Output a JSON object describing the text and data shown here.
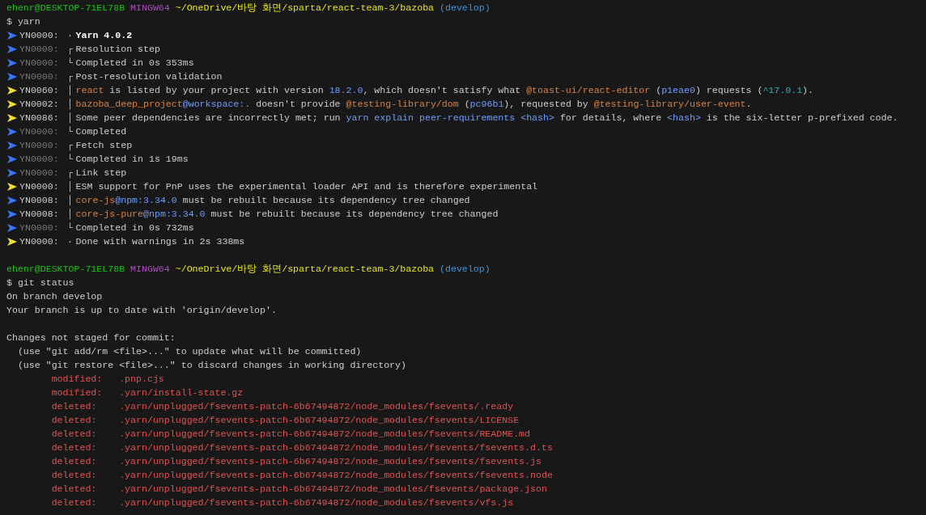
{
  "lines": [
    {
      "kind": "prompt",
      "segments": [
        {
          "kind": "user",
          "text": "ehenr@DESKTOP-71EL78B"
        },
        {
          "kind": "system",
          "text": "MINGW64"
        },
        {
          "kind": "path",
          "text": "~/OneDrive/바탕 화면/sparta/react-team-3/bazoba"
        },
        {
          "kind": "branch",
          "text": "(develop)"
        }
      ]
    },
    {
      "kind": "command",
      "text": "$ yarn"
    },
    {
      "kind": "yarn",
      "warning": false,
      "muted": false,
      "code": "YN0000:",
      "tree": "·",
      "segments": [
        {
          "kind": "bold",
          "text": "Yarn 4.0.2"
        }
      ]
    },
    {
      "kind": "yarn",
      "warning": false,
      "muted": true,
      "code": "YN0000:",
      "tree": "┌",
      "segments": [
        {
          "kind": "plain",
          "text": "Resolution step"
        }
      ]
    },
    {
      "kind": "yarn",
      "warning": false,
      "muted": true,
      "code": "YN0000:",
      "tree": "└",
      "segments": [
        {
          "kind": "plain",
          "text": "Completed in 0s 353ms"
        }
      ]
    },
    {
      "kind": "yarn",
      "warning": false,
      "muted": true,
      "code": "YN0000:",
      "tree": "┌",
      "segments": [
        {
          "kind": "plain",
          "text": "Post-resolution validation"
        }
      ]
    },
    {
      "kind": "yarn",
      "warning": true,
      "muted": false,
      "code": "YN0060:",
      "tree": "│",
      "segments": [
        {
          "kind": "package",
          "text": "react"
        },
        {
          "kind": "plain",
          "text": " is listed by your project with version "
        },
        {
          "kind": "reference",
          "text": "18.2.0"
        },
        {
          "kind": "plain",
          "text": ", which doesn't satisfy what "
        },
        {
          "kind": "package",
          "text": "@toast-ui/react-editor"
        },
        {
          "kind": "plain",
          "text": " ("
        },
        {
          "kind": "reference",
          "text": "p1eae0"
        },
        {
          "kind": "plain",
          "text": ") requests ("
        },
        {
          "kind": "range",
          "text": "^17.0.1"
        },
        {
          "kind": "plain",
          "text": ")."
        }
      ]
    },
    {
      "kind": "yarn",
      "warning": true,
      "muted": false,
      "code": "YN0002:",
      "tree": "│",
      "segments": [
        {
          "kind": "package",
          "text": "bazoba_deep_project"
        },
        {
          "kind": "reference",
          "text": "@workspace:."
        },
        {
          "kind": "plain",
          "text": " doesn't provide "
        },
        {
          "kind": "package",
          "text": "@testing-library/dom"
        },
        {
          "kind": "plain",
          "text": " ("
        },
        {
          "kind": "reference",
          "text": "pc96b1"
        },
        {
          "kind": "plain",
          "text": "), requested by "
        },
        {
          "kind": "package",
          "text": "@testing-library/user-event"
        },
        {
          "kind": "plain",
          "text": "."
        }
      ]
    },
    {
      "kind": "yarn",
      "warning": true,
      "muted": false,
      "code": "YN0086:",
      "tree": "│",
      "segments": [
        {
          "kind": "plain",
          "text": "Some peer dependencies are incorrectly met; run "
        },
        {
          "kind": "reference",
          "text": "yarn explain peer-requirements <hash>"
        },
        {
          "kind": "plain",
          "text": " for details, where "
        },
        {
          "kind": "reference",
          "text": "<hash>"
        },
        {
          "kind": "plain",
          "text": " is the six-letter p-prefixed code."
        }
      ]
    },
    {
      "kind": "yarn",
      "warning": false,
      "muted": true,
      "code": "YN0000:",
      "tree": "└",
      "segments": [
        {
          "kind": "plain",
          "text": "Completed"
        }
      ]
    },
    {
      "kind": "yarn",
      "warning": false,
      "muted": true,
      "code": "YN0000:",
      "tree": "┌",
      "segments": [
        {
          "kind": "plain",
          "text": "Fetch step"
        }
      ]
    },
    {
      "kind": "yarn",
      "warning": false,
      "muted": true,
      "code": "YN0000:",
      "tree": "└",
      "segments": [
        {
          "kind": "plain",
          "text": "Completed in 1s 19ms"
        }
      ]
    },
    {
      "kind": "yarn",
      "warning": false,
      "muted": true,
      "code": "YN0000:",
      "tree": "┌",
      "segments": [
        {
          "kind": "plain",
          "text": "Link step"
        }
      ]
    },
    {
      "kind": "yarn",
      "warning": true,
      "muted": false,
      "code": "YN0000:",
      "tree": "│",
      "segments": [
        {
          "kind": "plain",
          "text": "ESM support for PnP uses the experimental loader API and is therefore experimental"
        }
      ]
    },
    {
      "kind": "yarn",
      "warning": false,
      "muted": false,
      "code": "YN0008:",
      "tree": "│",
      "segments": [
        {
          "kind": "package",
          "text": "core-js"
        },
        {
          "kind": "reference",
          "text": "@npm:3.34.0"
        },
        {
          "kind": "plain",
          "text": " must be rebuilt because its dependency tree changed"
        }
      ]
    },
    {
      "kind": "yarn",
      "warning": false,
      "muted": false,
      "code": "YN0008:",
      "tree": "│",
      "segments": [
        {
          "kind": "package",
          "text": "core-js-pure"
        },
        {
          "kind": "reference",
          "text": "@npm:3.34.0"
        },
        {
          "kind": "plain",
          "text": " must be rebuilt because its dependency tree changed"
        }
      ]
    },
    {
      "kind": "yarn",
      "warning": false,
      "muted": true,
      "code": "YN0000:",
      "tree": "└",
      "segments": [
        {
          "kind": "plain",
          "text": "Completed in 0s 732ms"
        }
      ]
    },
    {
      "kind": "yarn",
      "warning": true,
      "muted": false,
      "code": "YN0000:",
      "tree": "·",
      "segments": [
        {
          "kind": "plain",
          "text": "Done with warnings in 2s 338ms"
        }
      ]
    },
    {
      "kind": "blank"
    },
    {
      "kind": "prompt",
      "segments": [
        {
          "kind": "user",
          "text": "ehenr@DESKTOP-71EL78B"
        },
        {
          "kind": "system",
          "text": "MINGW64"
        },
        {
          "kind": "path",
          "text": "~/OneDrive/바탕 화면/sparta/react-team-3/bazoba"
        },
        {
          "kind": "branch",
          "text": "(develop)"
        }
      ]
    },
    {
      "kind": "command",
      "text": "$ git status"
    },
    {
      "kind": "text",
      "text": "On branch develop"
    },
    {
      "kind": "text",
      "text": "Your branch is up to date with 'origin/develop'."
    },
    {
      "kind": "blank"
    },
    {
      "kind": "text",
      "text": "Changes not staged for commit:"
    },
    {
      "kind": "hint",
      "text": "(use \"git add/rm <file>...\" to update what will be committed)"
    },
    {
      "kind": "hint",
      "text": "(use \"git restore <file>...\" to discard changes in working directory)"
    },
    {
      "kind": "file",
      "text": "modified:   .pnp.cjs"
    },
    {
      "kind": "file",
      "text": "modified:   .yarn/install-state.gz"
    },
    {
      "kind": "file",
      "text": "deleted:    .yarn/unplugged/fsevents-patch-6b67494872/node_modules/fsevents/.ready"
    },
    {
      "kind": "file",
      "text": "deleted:    .yarn/unplugged/fsevents-patch-6b67494872/node_modules/fsevents/LICENSE"
    },
    {
      "kind": "file",
      "text": "deleted:    .yarn/unplugged/fsevents-patch-6b67494872/node_modules/fsevents/README.md"
    },
    {
      "kind": "file",
      "text": "deleted:    .yarn/unplugged/fsevents-patch-6b67494872/node_modules/fsevents/fsevents.d.ts"
    },
    {
      "kind": "file",
      "text": "deleted:    .yarn/unplugged/fsevents-patch-6b67494872/node_modules/fsevents/fsevents.js"
    },
    {
      "kind": "file",
      "text": "deleted:    .yarn/unplugged/fsevents-patch-6b67494872/node_modules/fsevents/fsevents.node"
    },
    {
      "kind": "file",
      "text": "deleted:    .yarn/unplugged/fsevents-patch-6b67494872/node_modules/fsevents/package.json"
    },
    {
      "kind": "file",
      "text": "deleted:    .yarn/unplugged/fsevents-patch-6b67494872/node_modules/fsevents/vfs.js"
    }
  ]
}
